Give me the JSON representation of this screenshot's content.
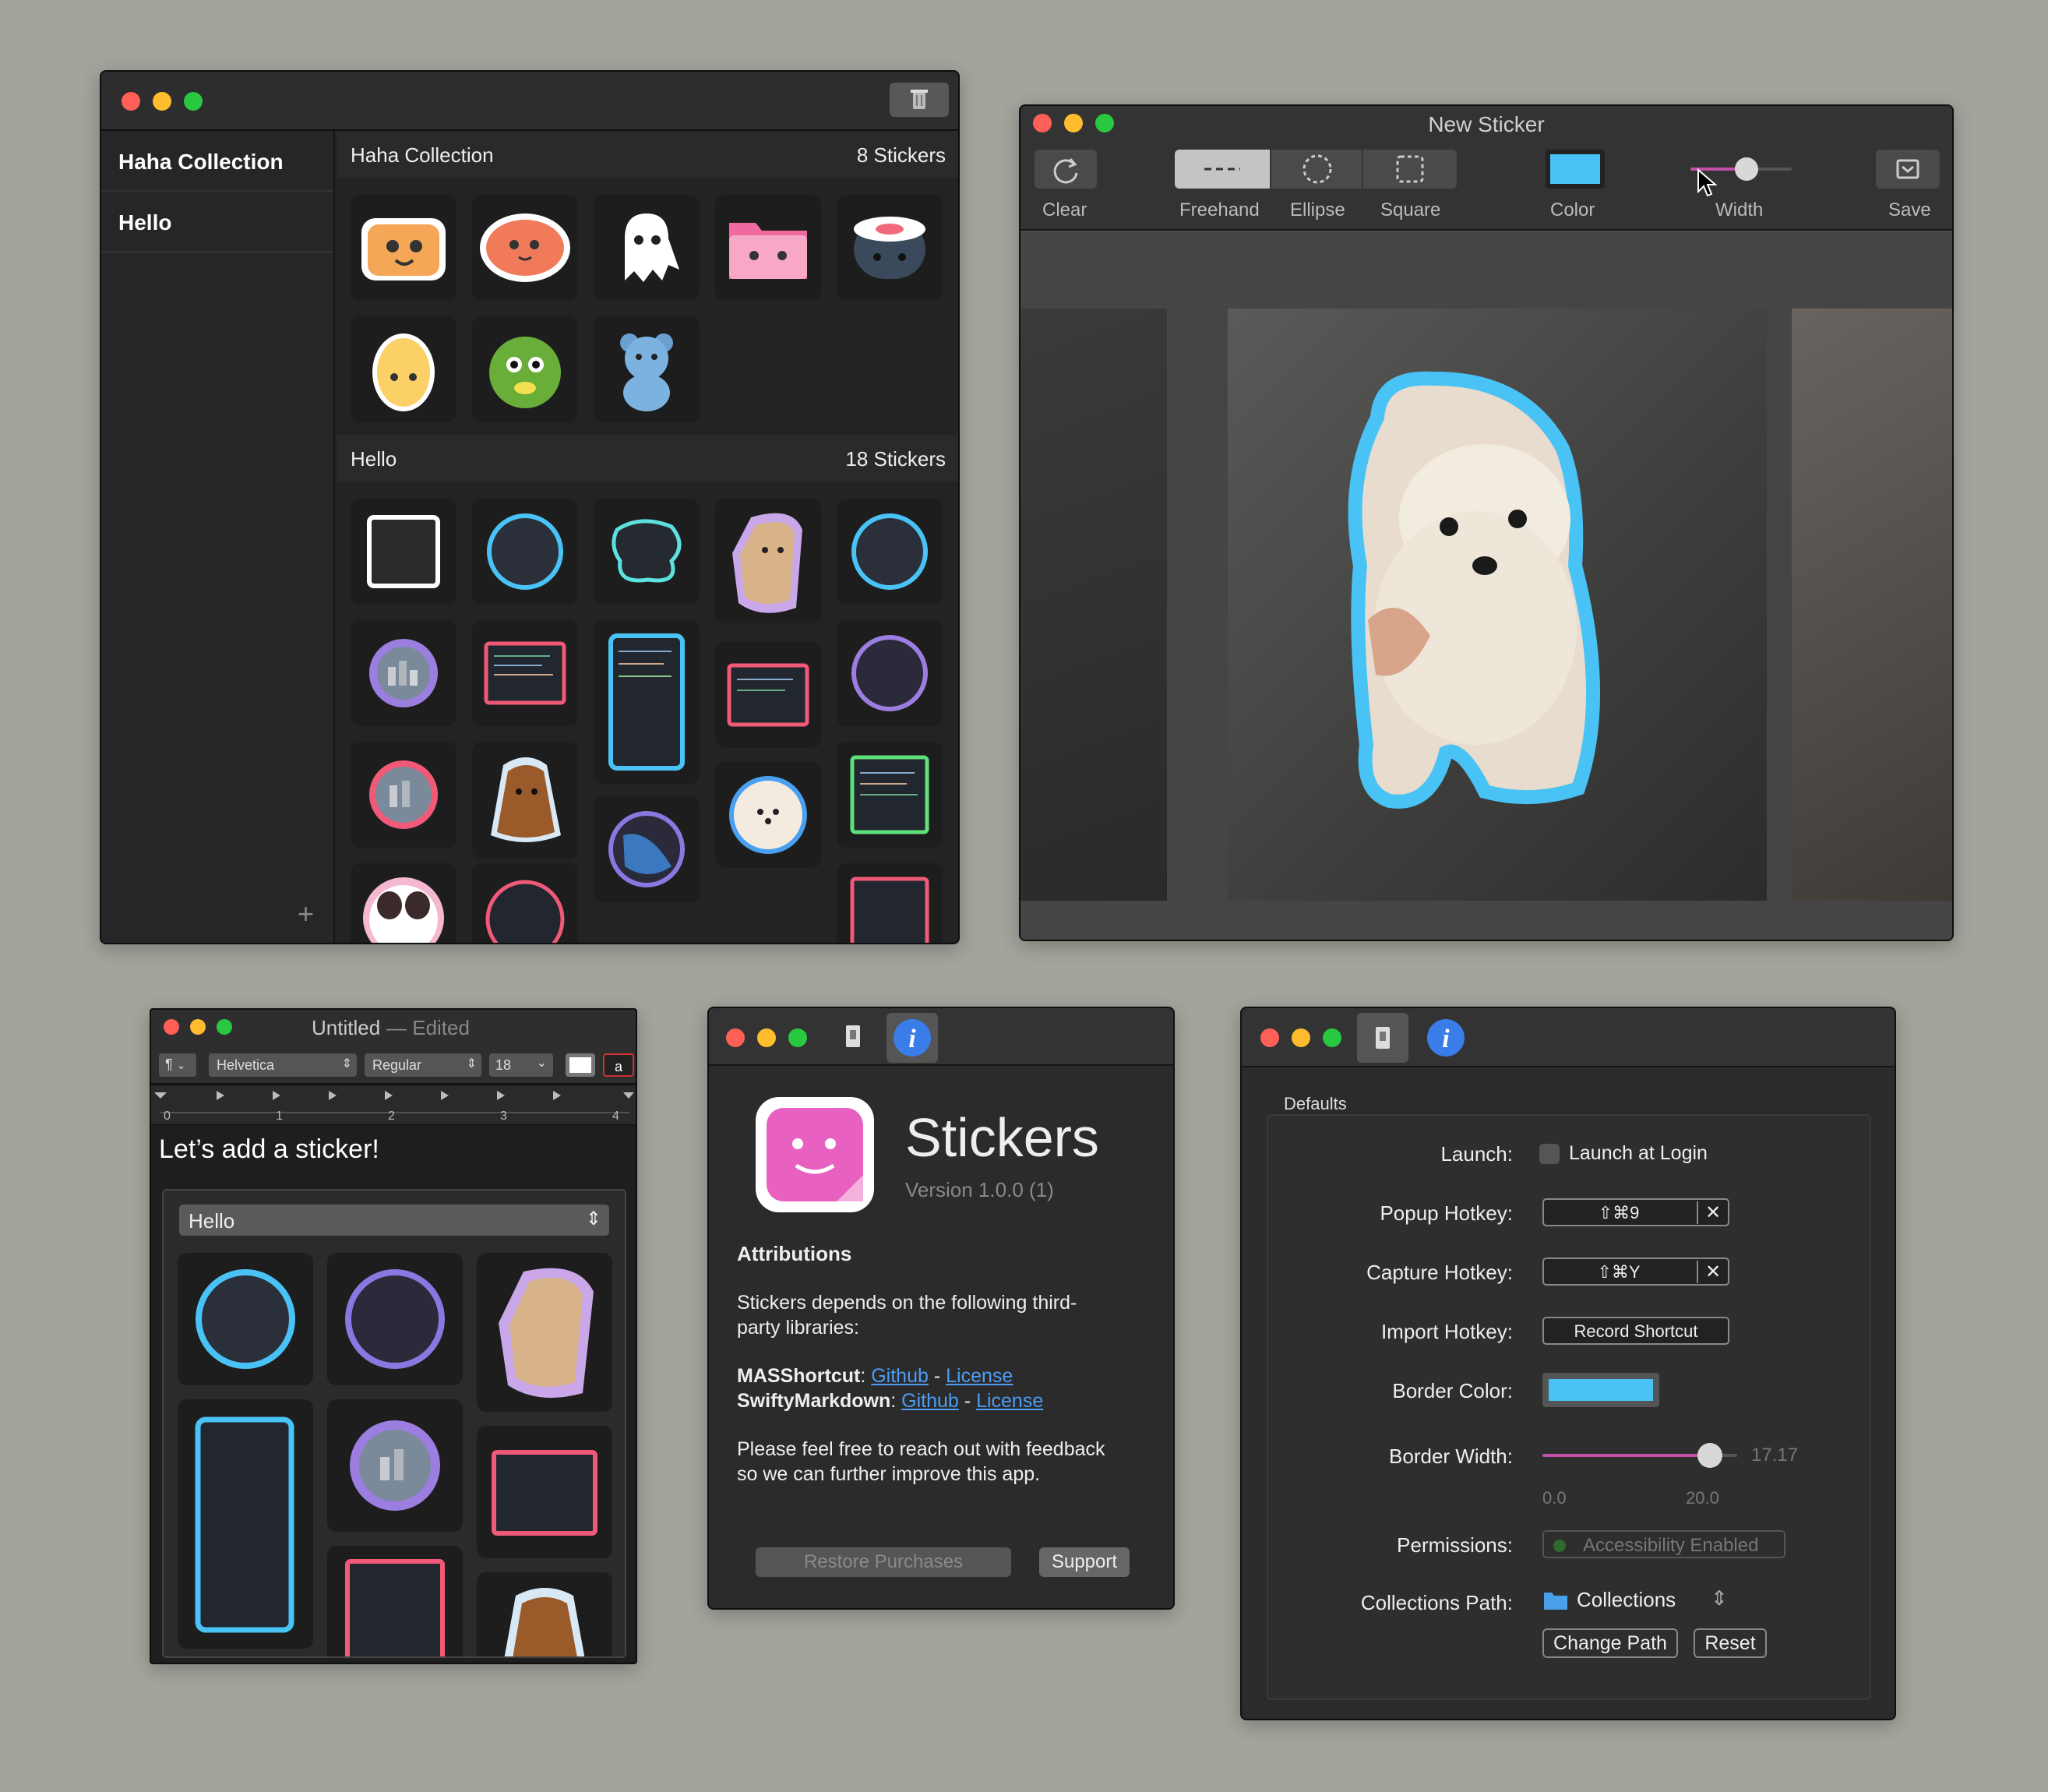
{
  "win_collection": {
    "sidebar_items": [
      {
        "label": "Haha Collection"
      },
      {
        "label": "Hello"
      }
    ],
    "add_label": "+",
    "sections": [
      {
        "title": "Haha Collection",
        "count": "8 Stickers"
      },
      {
        "title": "Hello",
        "count": "18 Stickers"
      }
    ]
  },
  "win_new_sticker": {
    "title": "New Sticker",
    "tools": {
      "clear": "Clear",
      "freehand": "Freehand",
      "ellipse": "Ellipse",
      "square": "Square",
      "color": "Color",
      "width": "Width",
      "save": "Save"
    },
    "border_color": "#49c3f5",
    "width_level": 0.55
  },
  "win_editor": {
    "title": "Untitled",
    "title_suffix": "— Edited",
    "paragraph": "¶",
    "font": "Helvetica",
    "style": "Regular",
    "size": "18",
    "ruler": [
      "0",
      "1",
      "2",
      "3",
      "4"
    ],
    "body_text": "Let’s add a sticker!",
    "popover_select": "Hello"
  },
  "win_about": {
    "app_name": "Stickers",
    "version": "Version 1.0.0 (1)",
    "attributions_heading": "Attributions",
    "intro_line1": "Stickers depends on the following third-",
    "intro_line2": "party libraries:",
    "libs": [
      {
        "name": "MASShortcut",
        "github": "Github",
        "sep": "-",
        "license": "License"
      },
      {
        "name": "SwiftyMarkdown",
        "github": "Github",
        "sep": "-",
        "license": "License"
      }
    ],
    "feedback_line1": "Please feel free to reach out with feedback",
    "feedback_line2": "so we can further improve this app.",
    "restore": "Restore Purchases",
    "support": "Support"
  },
  "win_prefs": {
    "group_title": "Defaults",
    "launch_label": "Launch:",
    "launch_checkbox": "Launch at Login",
    "popup_label": "Popup Hotkey:",
    "popup_value": "⇧⌘9",
    "capture_label": "Capture Hotkey:",
    "capture_value": "⇧⌘Y",
    "import_label": "Import Hotkey:",
    "import_value": "Record Shortcut",
    "clear_symbol": "✕",
    "border_color_label": "Border Color:",
    "border_color": "#49c3f5",
    "border_width_label": "Border Width:",
    "border_width_value": "17.17",
    "border_width_fraction": 0.858,
    "slider_min": "0.0",
    "slider_max": "20.0",
    "permissions_label": "Permissions:",
    "permissions_value": "Accessibility Enabled",
    "path_label": "Collections Path:",
    "path_value": "Collections",
    "change_path": "Change Path",
    "reset": "Reset"
  }
}
